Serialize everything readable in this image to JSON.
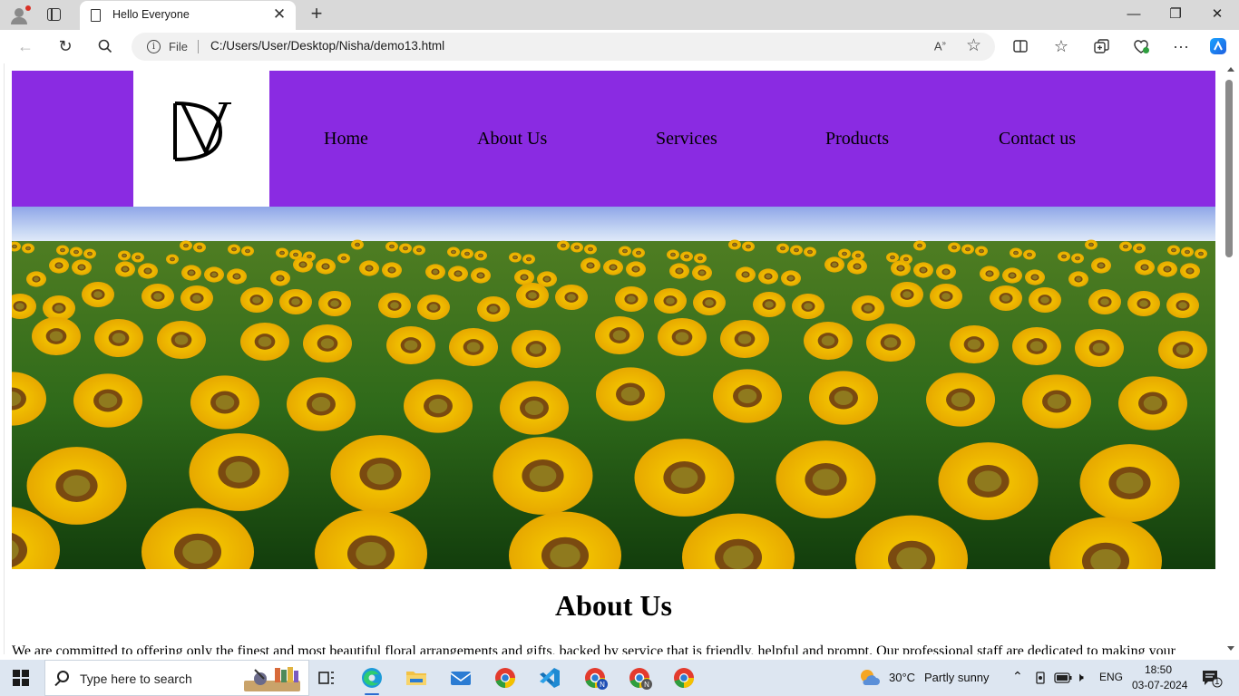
{
  "browser": {
    "tab_title": "Hello Everyone",
    "address_scheme": "File",
    "address_url": "C:/Users/User/Desktop/Nisha/demo13.html",
    "read_aloud_glyph": "A̅»",
    "icons": [
      "profile-icon",
      "tab-actions-icon",
      "page-icon",
      "close-icon",
      "new-tab-icon",
      "minimize-icon",
      "restore-icon",
      "window-close-icon",
      "back-icon",
      "refresh-icon",
      "search-icon",
      "info-icon",
      "read-aloud-icon",
      "favorite-star-icon",
      "split-screen-icon",
      "favorites-icon",
      "collections-icon",
      "browser-essentials-icon",
      "more-icon",
      "copilot-icon"
    ]
  },
  "site": {
    "colors": {
      "header_bg": "#8a2be2",
      "logo_bg": "#ffffff"
    },
    "logo_text": "DV",
    "nav": [
      "Home",
      "About Us",
      "Services",
      "Products",
      "Contact us"
    ],
    "hero_alt": "sunflower field",
    "about": {
      "heading": "About Us",
      "text": "We are committed to offering only the finest and most beautiful floral arrangements and gifts, backed by service that is friendly, helpful and prompt. Our professional staff are dedicated to making your"
    }
  },
  "taskbar": {
    "search_placeholder": "Type here to search",
    "weather_temp": "30°C",
    "weather_desc": "Partly sunny",
    "language": "ENG",
    "time": "18:50",
    "date": "03-07-2024",
    "notification_count": "1",
    "apps": [
      "task-view-icon",
      "edge-icon",
      "file-explorer-icon",
      "mail-icon",
      "chrome-icon",
      "vscode-icon",
      "chrome-profile-n-icon",
      "chrome-profile-n2-icon",
      "chrome-icon-2"
    ]
  }
}
